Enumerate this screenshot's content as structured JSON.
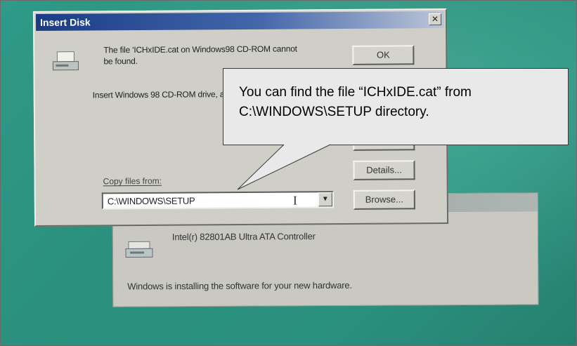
{
  "colors": {
    "desktop": "#2a8f7c",
    "titlebar": "#1a3c86",
    "callout_fill": "#e9e9e9"
  },
  "insert_disk_dialog": {
    "title": "Insert Disk",
    "close_icon": "close-icon",
    "message_line1": "The file 'ICHxIDE.cat on Windows98 CD-ROM cannot be found.",
    "message_line2": "Insert Windows 98 CD-ROM drive, and click OK.",
    "ok_label": "OK",
    "details_label": "Details...",
    "browse_label": "Browse...",
    "copy_from_label": "Copy files from:",
    "copy_from_value": "C:\\WINDOWS\\SETUP"
  },
  "install_dialog": {
    "device_name": "Intel(r) 82801AB Ultra ATA Controller",
    "status_text": "Windows is installing the software for your new hardware."
  },
  "callout": {
    "text": "You can find the file “ICHxIDE.cat” from C:\\WINDOWS\\SETUP directory."
  }
}
